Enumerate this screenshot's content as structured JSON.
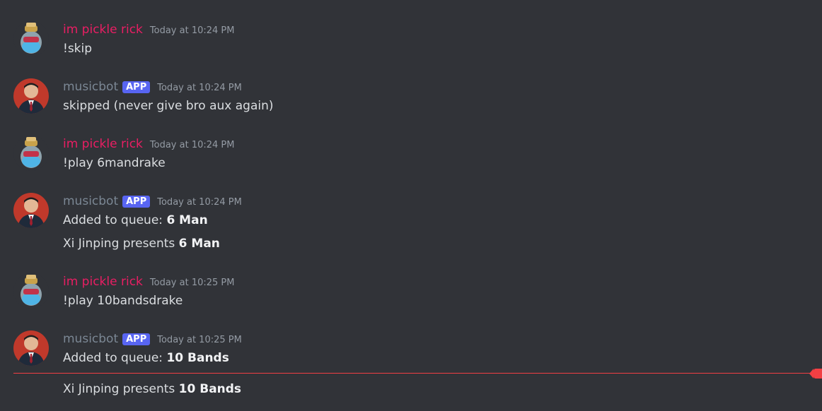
{
  "colors": {
    "background": "#313338",
    "pickle_rick_name": "#e91e63",
    "musicbot_name": "#7b8794",
    "app_badge": "#5865f2",
    "timestamp": "#949ba4",
    "message_text": "#dbdee1",
    "new_messages_divider": "#f23f43"
  },
  "messages": [
    {
      "username": "im pickle rick",
      "avatar_icon": "pickle-jar-avatar",
      "timestamp": "Today at 10:24 PM",
      "lines": [
        {
          "text": "!skip"
        }
      ]
    },
    {
      "username": "musicbot",
      "badge": "APP",
      "avatar_icon": "portrait-avatar",
      "timestamp": "Today at 10:24 PM",
      "lines": [
        {
          "text": "skipped (never give bro aux again)"
        }
      ]
    },
    {
      "username": "im pickle rick",
      "avatar_icon": "pickle-jar-avatar",
      "timestamp": "Today at 10:24 PM",
      "lines": [
        {
          "text": "!play 6mandrake"
        }
      ]
    },
    {
      "username": "musicbot",
      "badge": "APP",
      "avatar_icon": "portrait-avatar",
      "timestamp": "Today at 10:24 PM",
      "lines": [
        {
          "text": "Added to queue: ",
          "bold": "6 Man"
        },
        {
          "text": "Xi Jinping presents ",
          "bold": "6 Man"
        }
      ]
    },
    {
      "username": "im pickle rick",
      "avatar_icon": "pickle-jar-avatar",
      "timestamp": "Today at 10:25 PM",
      "lines": [
        {
          "text": "!play 10bandsdrake"
        }
      ]
    },
    {
      "username": "musicbot",
      "badge": "APP",
      "avatar_icon": "portrait-avatar",
      "timestamp": "Today at 10:25 PM",
      "lines": [
        {
          "text": "Added to queue: ",
          "bold": "10 Bands"
        },
        {
          "text": "Xi Jinping presents ",
          "bold": "10 Bands"
        }
      ]
    }
  ]
}
